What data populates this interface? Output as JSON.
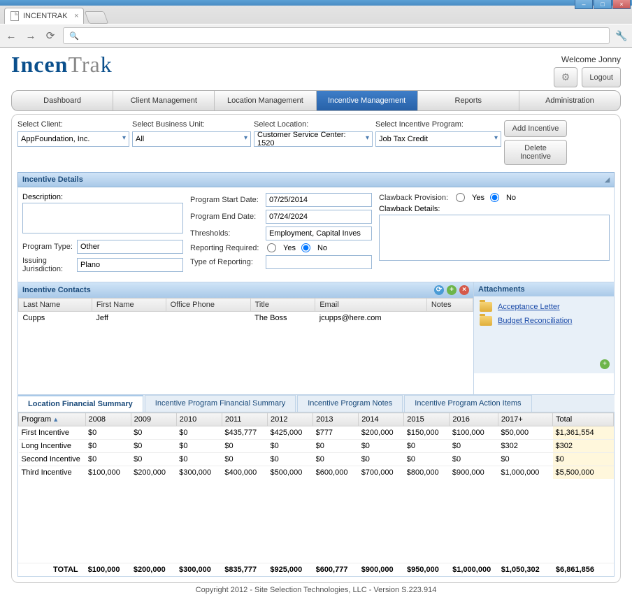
{
  "browser": {
    "tab_title": "INCENTRAK",
    "url_prefix": "🔍"
  },
  "header": {
    "logo_1": "Incen",
    "logo_2": "Tra",
    "logo_3": "k",
    "welcome": "Welcome Jonny",
    "logout": "Logout"
  },
  "nav": {
    "items": [
      "Dashboard",
      "Client Management",
      "Location Management",
      "Incentive Management",
      "Reports",
      "Administration"
    ],
    "active": 3
  },
  "filters": {
    "labels": {
      "client": "Select Client:",
      "bu": "Select Business Unit:",
      "loc": "Select Location:",
      "prog": "Select Incentive Program:"
    },
    "values": {
      "client": "AppFoundation, Inc.",
      "bu": "All",
      "loc": "Customer Service Center: 1520",
      "prog": "Job Tax Credit"
    },
    "actions": {
      "add": "Add Incentive",
      "del": "Delete Incentive"
    }
  },
  "details": {
    "title": "Incentive Details",
    "left": {
      "description_label": "Description:",
      "description_value": "",
      "program_type_label": "Program Type:",
      "program_type_value": "Other",
      "jurisdiction_label": "Issuing Jurisdiction:",
      "jurisdiction_value": "Plano"
    },
    "mid": {
      "start_label": "Program Start Date:",
      "start_value": "07/25/2014",
      "end_label": "Program End Date:",
      "end_value": "07/24/2024",
      "thresholds_label": "Thresholds:",
      "thresholds_value": "Employment, Capital Inves",
      "reporting_label": "Reporting Required:",
      "reporting_value": "No",
      "type_report_label": "Type of Reporting:",
      "type_report_value": ""
    },
    "right": {
      "claw_label": "Clawback Provision:",
      "claw_value": "No",
      "claw_details_label": "Clawback Details:"
    },
    "radio": {
      "yes": "Yes",
      "no": "No"
    }
  },
  "contacts": {
    "title": "Incentive Contacts",
    "cols": [
      "Last Name",
      "First Name",
      "Office Phone",
      "Title",
      "Email",
      "Notes"
    ],
    "rows": [
      {
        "last": "Cupps",
        "first": "Jeff",
        "phone": "",
        "title": "The Boss",
        "email": "jcupps@here.com",
        "notes": ""
      }
    ]
  },
  "attachments": {
    "title": "Attachments",
    "items": [
      "Acceptance Letter",
      "Budget Reconciliation"
    ]
  },
  "sub_tabs": {
    "items": [
      "Location Financial Summary",
      "Incentive Program Financial Summary",
      "Incentive Program Notes",
      "Incentive Program Action Items"
    ],
    "active": 0
  },
  "financial": {
    "cols": [
      "Program",
      "2008",
      "2009",
      "2010",
      "2011",
      "2012",
      "2013",
      "2014",
      "2015",
      "2016",
      "2017+",
      "Total"
    ],
    "rows": [
      {
        "name": "First Incentive",
        "vals": [
          "$0",
          "$0",
          "$0",
          "$435,777",
          "$425,000",
          "$777",
          "$200,000",
          "$150,000",
          "$100,000",
          "$50,000",
          "$1,361,554"
        ]
      },
      {
        "name": "Long Incentive",
        "vals": [
          "$0",
          "$0",
          "$0",
          "$0",
          "$0",
          "$0",
          "$0",
          "$0",
          "$0",
          "$302",
          "$302"
        ]
      },
      {
        "name": "Second Incentive",
        "vals": [
          "$0",
          "$0",
          "$0",
          "$0",
          "$0",
          "$0",
          "$0",
          "$0",
          "$0",
          "$0",
          "$0"
        ]
      },
      {
        "name": "Third Incentive",
        "vals": [
          "$100,000",
          "$200,000",
          "$300,000",
          "$400,000",
          "$500,000",
          "$600,000",
          "$700,000",
          "$800,000",
          "$900,000",
          "$1,000,000",
          "$5,500,000"
        ]
      }
    ],
    "totals": {
      "label": "TOTAL",
      "vals": [
        "$100,000",
        "$200,000",
        "$300,000",
        "$835,777",
        "$925,000",
        "$600,777",
        "$900,000",
        "$950,000",
        "$1,000,000",
        "$1,050,302",
        "$6,861,856"
      ]
    }
  },
  "footer": "Copyright 2012 - Site Selection Technologies, LLC - Version S.223.914"
}
